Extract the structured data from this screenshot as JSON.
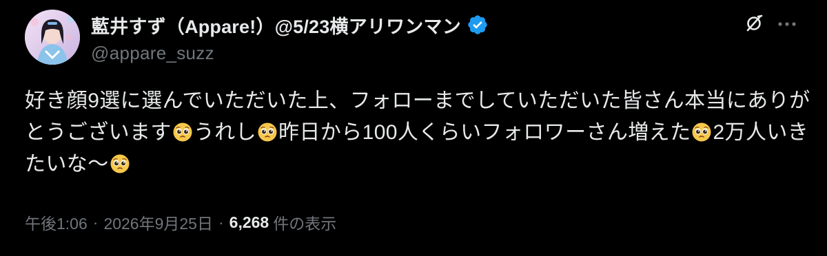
{
  "author": {
    "display_name": "藍井すず（Appare!）@5/23横アリワンマン",
    "handle": "@appare_suzz",
    "verified": true
  },
  "tweet": {
    "segments": [
      {
        "text": "好き顔9選に選んでいただいた上、フォローまでしていただいた皆さん本当にありがとうございます"
      },
      {
        "emoji": "pleading-face-icon"
      },
      {
        "text": "うれし"
      },
      {
        "emoji": "pleading-face-icon"
      },
      {
        "text": "昨日から100人くらいフォロワーさん増えた"
      },
      {
        "emoji": "pleading-face-icon"
      },
      {
        "text": "2万人いきたいな〜"
      },
      {
        "emoji": "pleading-face-icon"
      }
    ]
  },
  "meta": {
    "time": "午後1:06",
    "separator": "·",
    "date": "2026年9月25日",
    "views_count": "6,268",
    "views_label": "件の表示"
  },
  "colors": {
    "background": "#000000",
    "primary_text": "#e7e9ea",
    "secondary_text": "#71767b",
    "verified_badge": "#1d9bf0"
  }
}
